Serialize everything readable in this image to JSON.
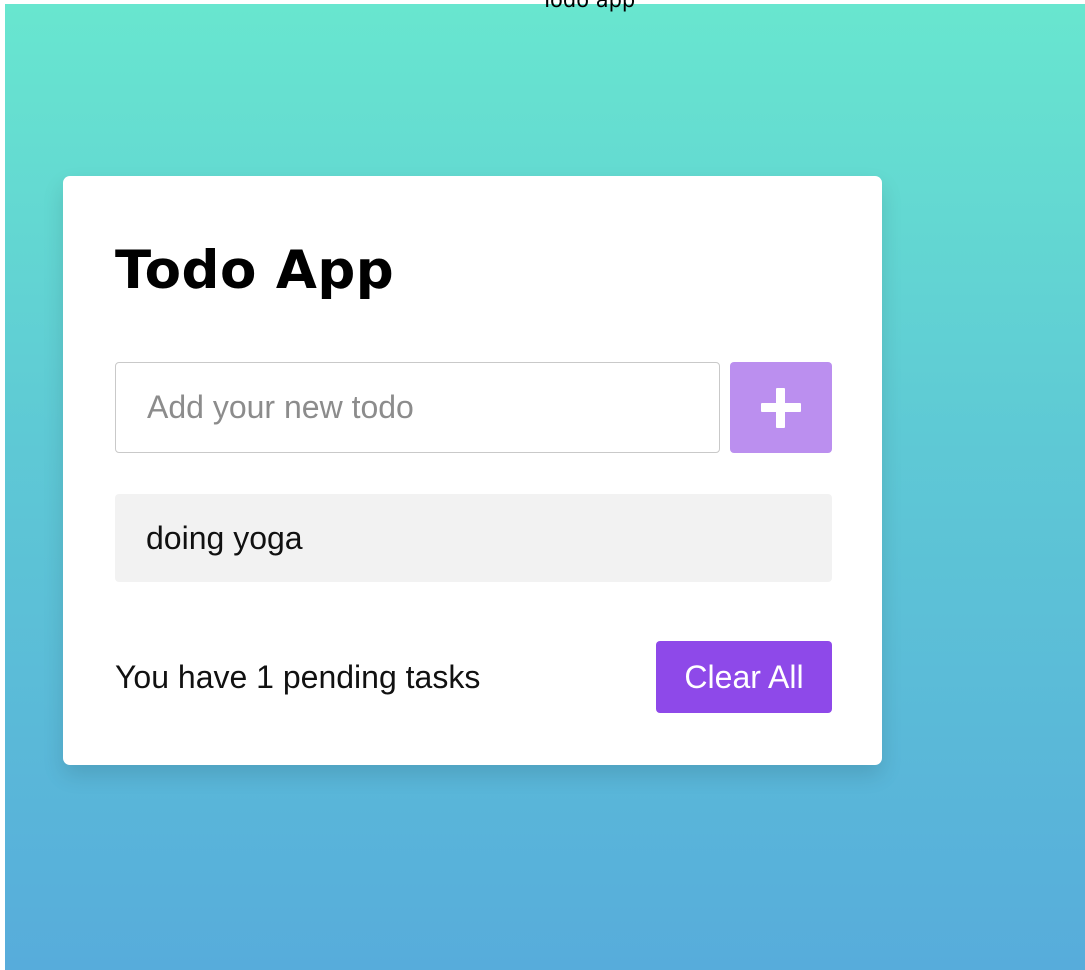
{
  "document": {
    "title": "Todo app"
  },
  "app": {
    "title": "Todo App",
    "input": {
      "placeholder": "Add your new todo",
      "value": ""
    },
    "add_button_icon": "plus-icon",
    "todos": [
      {
        "text": "doing yoga"
      }
    ],
    "footer": {
      "pending_text": "You have 1 pending tasks",
      "clear_label": "Clear All"
    }
  },
  "colors": {
    "gradient_top": "#68e6cf",
    "gradient_bottom": "#57acdb",
    "add_button": "#bb8fef",
    "clear_button": "#8e49e9",
    "todo_item_bg": "#f2f2f2"
  }
}
